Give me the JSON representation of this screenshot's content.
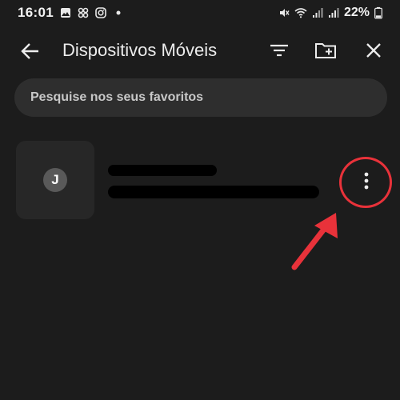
{
  "status_bar": {
    "time": "16:01",
    "battery": "22%",
    "icons_left": [
      "gallery-icon",
      "slack-icon",
      "instagram-icon",
      "dot-icon"
    ],
    "icons_right": [
      "mute-icon",
      "wifi-icon",
      "signal-icon",
      "signal-icon"
    ]
  },
  "app_bar": {
    "title": "Dispositivos Móveis",
    "icons": [
      "back-arrow-icon",
      "filter-icon",
      "new-folder-icon",
      "close-icon"
    ]
  },
  "search": {
    "placeholder": "Pesquise nos seus favoritos"
  },
  "list": {
    "items": [
      {
        "avatar_letter": "J",
        "title": "",
        "subtitle": "",
        "menu_icon": "more-vertical-icon"
      }
    ]
  },
  "annotation": {
    "color": "#e8323a"
  },
  "colors": {
    "background": "#1c1c1c",
    "search_background": "#2e2e2e",
    "thumbnail_background": "#272727",
    "avatar_background": "#595959"
  }
}
